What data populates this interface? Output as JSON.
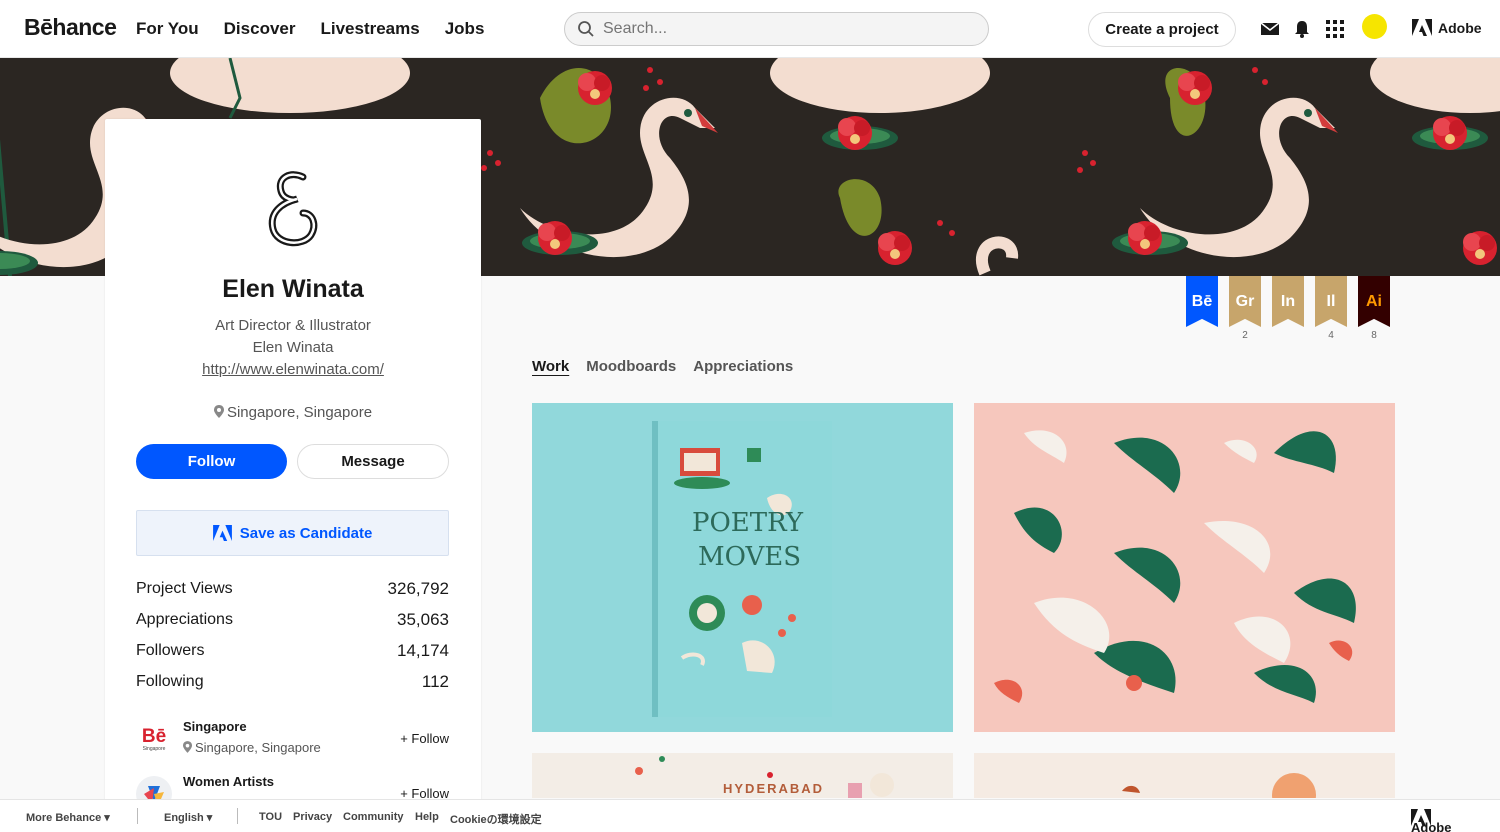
{
  "nav": {
    "logo": "Bēhance",
    "links": [
      "For You",
      "Discover",
      "Livestreams",
      "Jobs"
    ],
    "search_placeholder": "Search...",
    "create_label": "Create a project",
    "adobe_label": "Adobe"
  },
  "profile": {
    "name": "Elen Winata",
    "occupation": "Art Director & Illustrator",
    "company": "Elen Winata",
    "website": "http://www.elenwinata.com/",
    "location": "Singapore, Singapore",
    "follow_label": "Follow",
    "message_label": "Message",
    "candidate_label": "Save as Candidate",
    "stats": [
      {
        "label": "Project Views",
        "value": "326,792"
      },
      {
        "label": "Appreciations",
        "value": "35,063"
      },
      {
        "label": "Followers",
        "value": "14,174"
      },
      {
        "label": "Following",
        "value": "112"
      }
    ],
    "teams": [
      {
        "name": "Singapore",
        "location": "Singapore, Singapore",
        "follow": "+ Follow",
        "logo_text": "Bē",
        "logo_sub": "Singapore"
      },
      {
        "name": "Women Artists",
        "location": "",
        "follow": "+ Follow"
      }
    ]
  },
  "badges": [
    {
      "label": "Bē",
      "count": "",
      "color": "#0057ff"
    },
    {
      "label": "Gr",
      "count": "2",
      "color": "#c7a56b"
    },
    {
      "label": "In",
      "count": "",
      "color": "#c7a56b"
    },
    {
      "label": "Il",
      "count": "4",
      "color": "#c7a56b"
    },
    {
      "label": "Ai",
      "count": "8",
      "color": "#330000"
    }
  ],
  "tabs": [
    {
      "label": "Work",
      "active": true
    },
    {
      "label": "Moodboards",
      "active": false
    },
    {
      "label": "Appreciations",
      "active": false
    }
  ],
  "projects": {
    "third_label": "HYDERABAD"
  },
  "footer": {
    "more": "More Behance ▾",
    "language": "English ▾",
    "links": [
      "TOU",
      "Privacy",
      "Community",
      "Help",
      "Cookieの環境設定"
    ],
    "adobe": "Adobe"
  },
  "colors": {
    "accent": "#0057ff",
    "banner_bg": "#2b2622",
    "project1_bg": "#91d8db",
    "project2_bg": "#f6c7bd"
  }
}
